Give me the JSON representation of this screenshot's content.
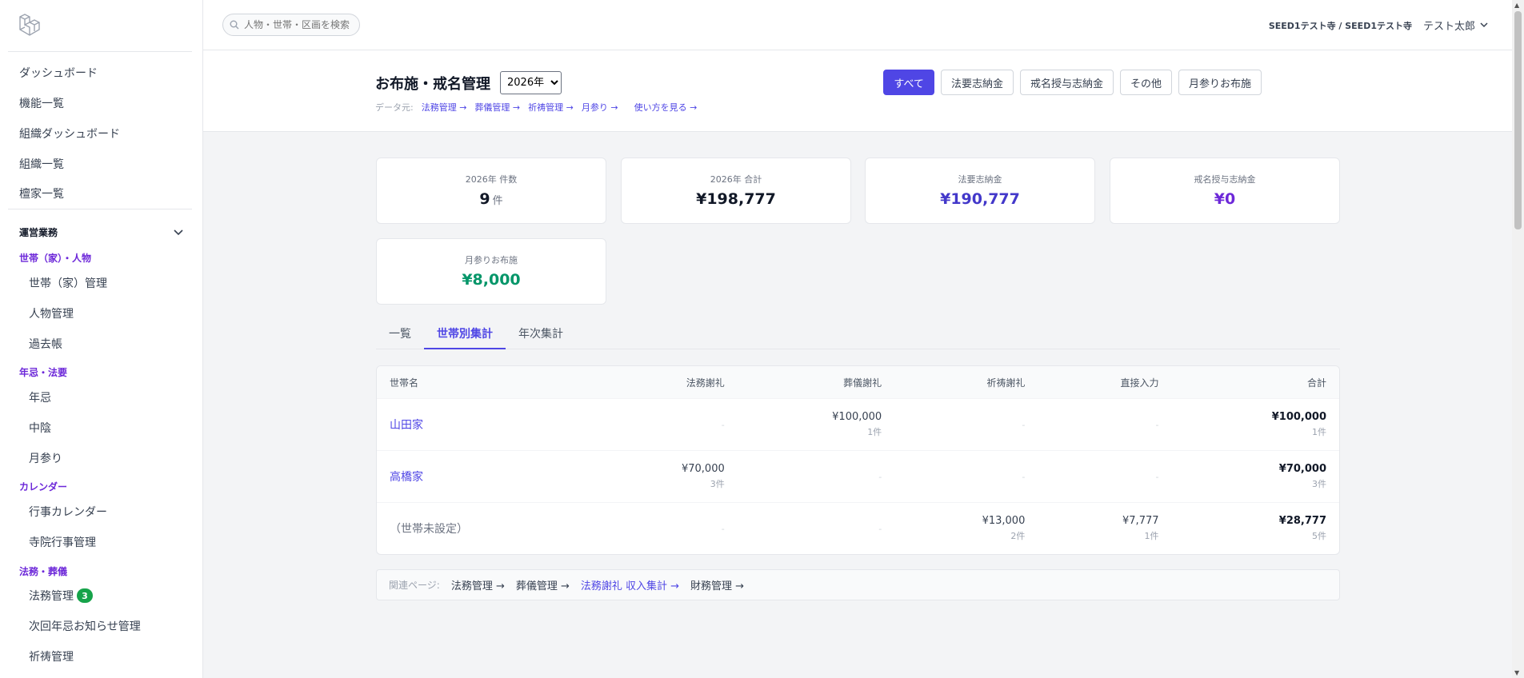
{
  "search": {
    "placeholder": "人物・世帯・区画を検索"
  },
  "account": {
    "org": "SEED1テスト寺 / SEED1テスト寺",
    "user": "テスト太郎"
  },
  "sidebar": {
    "top_items": [
      "ダッシュボード",
      "機能一覧",
      "組織ダッシュボード",
      "組織一覧",
      "檀家一覧"
    ],
    "group": "運営業務",
    "cat_household": "世帯（家）・人物",
    "household_items": [
      "世帯（家）管理",
      "人物管理",
      "過去帳"
    ],
    "cat_memorial": "年忌・法要",
    "memorial_items": [
      "年忌",
      "中陰",
      "月参り"
    ],
    "cat_calendar": "カレンダー",
    "calendar_items": [
      "行事カレンダー",
      "寺院行事管理"
    ],
    "cat_rites": "法務・葬儀",
    "rites_items": [
      "法務管理",
      "次回年忌お知らせ管理",
      "祈祷管理"
    ],
    "rites_badge": "3"
  },
  "header": {
    "title": "お布施・戒名管理",
    "year_selected": "2026年",
    "datasrc_label": "データ元:",
    "datasrc_links": [
      "法務管理 →",
      "葬儀管理 →",
      "祈祷管理 →",
      "月参り →",
      "使い方を見る →"
    ],
    "filters": [
      "すべて",
      "法要志納金",
      "戒名授与志納金",
      "その他",
      "月参りお布施"
    ]
  },
  "cards": [
    {
      "label": "2026年 件数",
      "value": "9",
      "unit": "件",
      "color": "#111827"
    },
    {
      "label": "2026年 合計",
      "value": "¥198,777",
      "unit": "",
      "color": "#111827"
    },
    {
      "label": "法要志納金",
      "value": "¥190,777",
      "unit": "",
      "color": "#4338ca"
    },
    {
      "label": "戒名授与志納金",
      "value": "¥0",
      "unit": "",
      "color": "#6d28d9"
    },
    {
      "label": "月参りお布施",
      "value": "¥8,000",
      "unit": "",
      "color": "#059669"
    }
  ],
  "tabs": [
    "一覧",
    "世帯別集計",
    "年次集計"
  ],
  "table": {
    "headers": [
      "世帯名",
      "法務謝礼",
      "葬儀謝礼",
      "祈祷謝礼",
      "直接入力",
      "合計"
    ],
    "rows": [
      {
        "name": "山田家",
        "cells": [
          {
            "amt": "-",
            "cnt": ""
          },
          {
            "amt": "¥100,000",
            "cnt": "1件"
          },
          {
            "amt": "-",
            "cnt": ""
          },
          {
            "amt": "-",
            "cnt": ""
          },
          {
            "amt": "¥100,000",
            "cnt": "1件"
          }
        ]
      },
      {
        "name": "高橋家",
        "cells": [
          {
            "amt": "¥70,000",
            "cnt": "3件"
          },
          {
            "amt": "-",
            "cnt": ""
          },
          {
            "amt": "-",
            "cnt": ""
          },
          {
            "amt": "-",
            "cnt": ""
          },
          {
            "amt": "¥70,000",
            "cnt": "3件"
          }
        ]
      },
      {
        "name": "（世帯未設定）",
        "cells": [
          {
            "amt": "-",
            "cnt": ""
          },
          {
            "amt": "-",
            "cnt": ""
          },
          {
            "amt": "¥13,000",
            "cnt": "2件"
          },
          {
            "amt": "¥7,777",
            "cnt": "1件"
          },
          {
            "amt": "¥28,777",
            "cnt": "5件"
          }
        ]
      }
    ]
  },
  "related": {
    "label": "関連ページ:",
    "links": [
      "法務管理 →",
      "葬儀管理 →",
      "法務謝礼 収入集計 →",
      "財務管理 →"
    ]
  }
}
